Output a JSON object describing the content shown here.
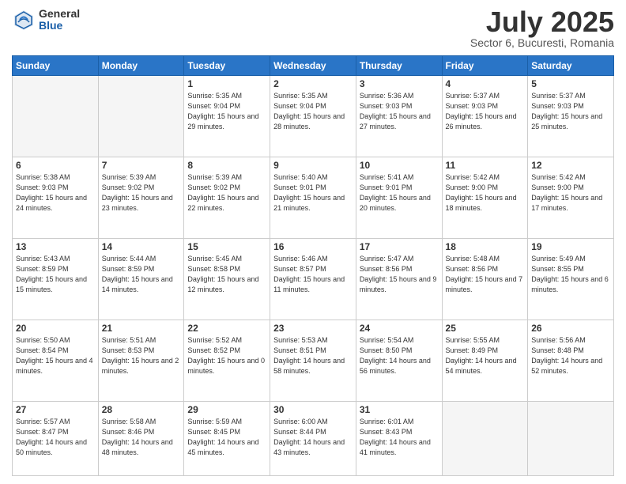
{
  "header": {
    "logo_general": "General",
    "logo_blue": "Blue",
    "month_title": "July 2025",
    "subtitle": "Sector 6, Bucuresti, Romania"
  },
  "days_of_week": [
    "Sunday",
    "Monday",
    "Tuesday",
    "Wednesday",
    "Thursday",
    "Friday",
    "Saturday"
  ],
  "weeks": [
    [
      {
        "day": "",
        "info": ""
      },
      {
        "day": "",
        "info": ""
      },
      {
        "day": "1",
        "info": "Sunrise: 5:35 AM\nSunset: 9:04 PM\nDaylight: 15 hours\nand 29 minutes."
      },
      {
        "day": "2",
        "info": "Sunrise: 5:35 AM\nSunset: 9:04 PM\nDaylight: 15 hours\nand 28 minutes."
      },
      {
        "day": "3",
        "info": "Sunrise: 5:36 AM\nSunset: 9:03 PM\nDaylight: 15 hours\nand 27 minutes."
      },
      {
        "day": "4",
        "info": "Sunrise: 5:37 AM\nSunset: 9:03 PM\nDaylight: 15 hours\nand 26 minutes."
      },
      {
        "day": "5",
        "info": "Sunrise: 5:37 AM\nSunset: 9:03 PM\nDaylight: 15 hours\nand 25 minutes."
      }
    ],
    [
      {
        "day": "6",
        "info": "Sunrise: 5:38 AM\nSunset: 9:03 PM\nDaylight: 15 hours\nand 24 minutes."
      },
      {
        "day": "7",
        "info": "Sunrise: 5:39 AM\nSunset: 9:02 PM\nDaylight: 15 hours\nand 23 minutes."
      },
      {
        "day": "8",
        "info": "Sunrise: 5:39 AM\nSunset: 9:02 PM\nDaylight: 15 hours\nand 22 minutes."
      },
      {
        "day": "9",
        "info": "Sunrise: 5:40 AM\nSunset: 9:01 PM\nDaylight: 15 hours\nand 21 minutes."
      },
      {
        "day": "10",
        "info": "Sunrise: 5:41 AM\nSunset: 9:01 PM\nDaylight: 15 hours\nand 20 minutes."
      },
      {
        "day": "11",
        "info": "Sunrise: 5:42 AM\nSunset: 9:00 PM\nDaylight: 15 hours\nand 18 minutes."
      },
      {
        "day": "12",
        "info": "Sunrise: 5:42 AM\nSunset: 9:00 PM\nDaylight: 15 hours\nand 17 minutes."
      }
    ],
    [
      {
        "day": "13",
        "info": "Sunrise: 5:43 AM\nSunset: 8:59 PM\nDaylight: 15 hours\nand 15 minutes."
      },
      {
        "day": "14",
        "info": "Sunrise: 5:44 AM\nSunset: 8:59 PM\nDaylight: 15 hours\nand 14 minutes."
      },
      {
        "day": "15",
        "info": "Sunrise: 5:45 AM\nSunset: 8:58 PM\nDaylight: 15 hours\nand 12 minutes."
      },
      {
        "day": "16",
        "info": "Sunrise: 5:46 AM\nSunset: 8:57 PM\nDaylight: 15 hours\nand 11 minutes."
      },
      {
        "day": "17",
        "info": "Sunrise: 5:47 AM\nSunset: 8:56 PM\nDaylight: 15 hours\nand 9 minutes."
      },
      {
        "day": "18",
        "info": "Sunrise: 5:48 AM\nSunset: 8:56 PM\nDaylight: 15 hours\nand 7 minutes."
      },
      {
        "day": "19",
        "info": "Sunrise: 5:49 AM\nSunset: 8:55 PM\nDaylight: 15 hours\nand 6 minutes."
      }
    ],
    [
      {
        "day": "20",
        "info": "Sunrise: 5:50 AM\nSunset: 8:54 PM\nDaylight: 15 hours\nand 4 minutes."
      },
      {
        "day": "21",
        "info": "Sunrise: 5:51 AM\nSunset: 8:53 PM\nDaylight: 15 hours\nand 2 minutes."
      },
      {
        "day": "22",
        "info": "Sunrise: 5:52 AM\nSunset: 8:52 PM\nDaylight: 15 hours\nand 0 minutes."
      },
      {
        "day": "23",
        "info": "Sunrise: 5:53 AM\nSunset: 8:51 PM\nDaylight: 14 hours\nand 58 minutes."
      },
      {
        "day": "24",
        "info": "Sunrise: 5:54 AM\nSunset: 8:50 PM\nDaylight: 14 hours\nand 56 minutes."
      },
      {
        "day": "25",
        "info": "Sunrise: 5:55 AM\nSunset: 8:49 PM\nDaylight: 14 hours\nand 54 minutes."
      },
      {
        "day": "26",
        "info": "Sunrise: 5:56 AM\nSunset: 8:48 PM\nDaylight: 14 hours\nand 52 minutes."
      }
    ],
    [
      {
        "day": "27",
        "info": "Sunrise: 5:57 AM\nSunset: 8:47 PM\nDaylight: 14 hours\nand 50 minutes."
      },
      {
        "day": "28",
        "info": "Sunrise: 5:58 AM\nSunset: 8:46 PM\nDaylight: 14 hours\nand 48 minutes."
      },
      {
        "day": "29",
        "info": "Sunrise: 5:59 AM\nSunset: 8:45 PM\nDaylight: 14 hours\nand 45 minutes."
      },
      {
        "day": "30",
        "info": "Sunrise: 6:00 AM\nSunset: 8:44 PM\nDaylight: 14 hours\nand 43 minutes."
      },
      {
        "day": "31",
        "info": "Sunrise: 6:01 AM\nSunset: 8:43 PM\nDaylight: 14 hours\nand 41 minutes."
      },
      {
        "day": "",
        "info": ""
      },
      {
        "day": "",
        "info": ""
      }
    ]
  ]
}
